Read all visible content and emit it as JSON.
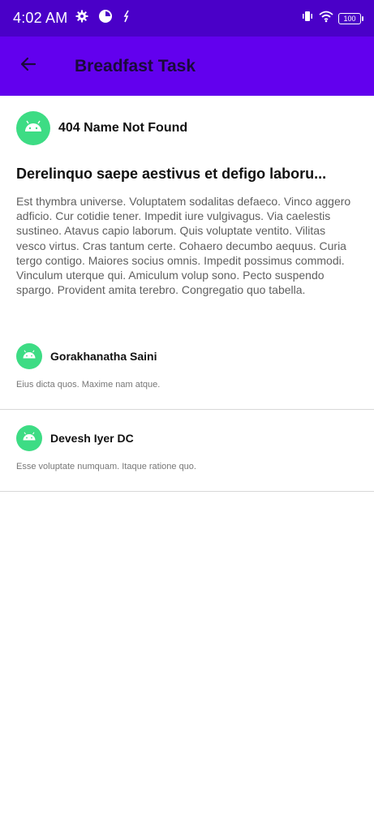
{
  "status_bar": {
    "time": "4:02 AM",
    "battery": "100",
    "icons": [
      "gear-icon",
      "app-circle-icon",
      "sync-icon",
      "vibrate-icon",
      "wifi-icon",
      "battery-icon"
    ]
  },
  "app_bar": {
    "title": "Breadfast Task",
    "back_icon": "arrow-back-icon",
    "background": "#6200ee"
  },
  "post": {
    "author": "404 Name Not Found",
    "title": "Derelinquo saepe aestivus et defigo laboru...",
    "body": "Est thymbra universe. Voluptatem sodalitas defaeco. Vinco aggero adficio. Cur cotidie tener. Impedit iure vulgivagus. Via caelestis sustineo. Atavus capio laborum. Quis voluptate ventito. Vilitas vesco virtus. Cras tantum certe. Cohaero decumbo aequus. Curia tergo contigo. Maiores socius omnis. Impedit possimus commodi. Vinculum uterque qui. Amiculum volup sono. Pecto suspendo spargo. Provident amita terebro. Congregatio quo tabella."
  },
  "comments": [
    {
      "author": "Gorakhanatha Saini",
      "body": "Eius dicta quos. Maxime nam atque."
    },
    {
      "author": "Devesh Iyer DC",
      "body": "Esse voluptate numquam. Itaque ratione quo."
    }
  ],
  "colors": {
    "status_bar": "#4a00c8",
    "app_bar": "#6200ee",
    "avatar": "#3ddc84"
  }
}
